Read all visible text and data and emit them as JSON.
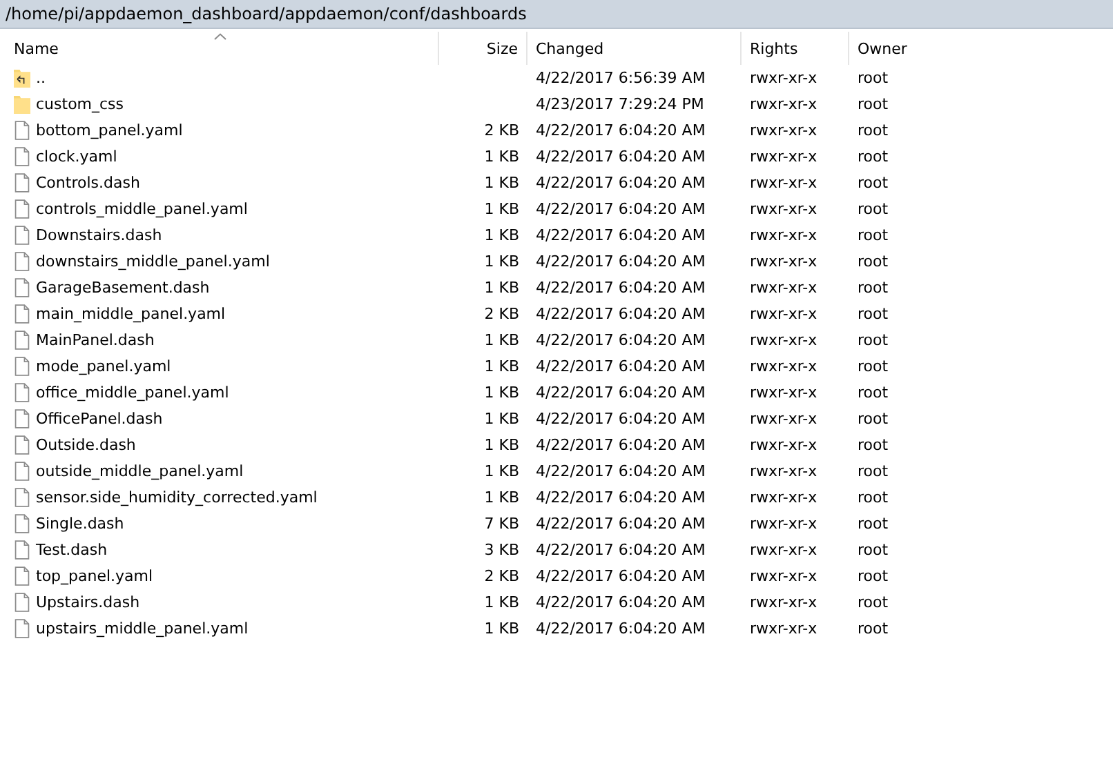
{
  "path_bar": {
    "path": "/home/pi/appdaemon_dashboard/appdaemon/conf/dashboards"
  },
  "columns": [
    {
      "label": "Name",
      "sorted": true
    },
    {
      "label": "Size",
      "sorted": false
    },
    {
      "label": "Changed",
      "sorted": false
    },
    {
      "label": "Rights",
      "sorted": false
    },
    {
      "label": "Owner",
      "sorted": false
    }
  ],
  "rows": [
    {
      "kind": "up",
      "name": "..",
      "changed": "4/22/2017 6:56:39 AM",
      "rights": "rwxr-xr-x",
      "owner": "root"
    },
    {
      "kind": "folder",
      "name": "custom_css",
      "changed": "4/23/2017 7:29:24 PM",
      "rights": "rwxr-xr-x",
      "owner": "root"
    },
    {
      "kind": "file",
      "name": "bottom_panel.yaml",
      "size": "2 KB",
      "changed": "4/22/2017 6:04:20 AM",
      "rights": "rwxr-xr-x",
      "owner": "root"
    },
    {
      "kind": "file",
      "name": "clock.yaml",
      "size": "1 KB",
      "changed": "4/22/2017 6:04:20 AM",
      "rights": "rwxr-xr-x",
      "owner": "root"
    },
    {
      "kind": "file",
      "name": "Controls.dash",
      "size": "1 KB",
      "changed": "4/22/2017 6:04:20 AM",
      "rights": "rwxr-xr-x",
      "owner": "root"
    },
    {
      "kind": "file",
      "name": "controls_middle_panel.yaml",
      "size": "1 KB",
      "changed": "4/22/2017 6:04:20 AM",
      "rights": "rwxr-xr-x",
      "owner": "root"
    },
    {
      "kind": "file",
      "name": "Downstairs.dash",
      "size": "1 KB",
      "changed": "4/22/2017 6:04:20 AM",
      "rights": "rwxr-xr-x",
      "owner": "root"
    },
    {
      "kind": "file",
      "name": "downstairs_middle_panel.yaml",
      "size": "1 KB",
      "changed": "4/22/2017 6:04:20 AM",
      "rights": "rwxr-xr-x",
      "owner": "root"
    },
    {
      "kind": "file",
      "name": "GarageBasement.dash",
      "size": "1 KB",
      "changed": "4/22/2017 6:04:20 AM",
      "rights": "rwxr-xr-x",
      "owner": "root"
    },
    {
      "kind": "file",
      "name": "main_middle_panel.yaml",
      "size": "2 KB",
      "changed": "4/22/2017 6:04:20 AM",
      "rights": "rwxr-xr-x",
      "owner": "root"
    },
    {
      "kind": "file",
      "name": "MainPanel.dash",
      "size": "1 KB",
      "changed": "4/22/2017 6:04:20 AM",
      "rights": "rwxr-xr-x",
      "owner": "root"
    },
    {
      "kind": "file",
      "name": "mode_panel.yaml",
      "size": "1 KB",
      "changed": "4/22/2017 6:04:20 AM",
      "rights": "rwxr-xr-x",
      "owner": "root"
    },
    {
      "kind": "file",
      "name": "office_middle_panel.yaml",
      "size": "1 KB",
      "changed": "4/22/2017 6:04:20 AM",
      "rights": "rwxr-xr-x",
      "owner": "root"
    },
    {
      "kind": "file",
      "name": "OfficePanel.dash",
      "size": "1 KB",
      "changed": "4/22/2017 6:04:20 AM",
      "rights": "rwxr-xr-x",
      "owner": "root"
    },
    {
      "kind": "file",
      "name": "Outside.dash",
      "size": "1 KB",
      "changed": "4/22/2017 6:04:20 AM",
      "rights": "rwxr-xr-x",
      "owner": "root"
    },
    {
      "kind": "file",
      "name": "outside_middle_panel.yaml",
      "size": "1 KB",
      "changed": "4/22/2017 6:04:20 AM",
      "rights": "rwxr-xr-x",
      "owner": "root"
    },
    {
      "kind": "file",
      "name": "sensor.side_humidity_corrected.yaml",
      "size": "1 KB",
      "changed": "4/22/2017 6:04:20 AM",
      "rights": "rwxr-xr-x",
      "owner": "root"
    },
    {
      "kind": "file",
      "name": "Single.dash",
      "size": "7 KB",
      "changed": "4/22/2017 6:04:20 AM",
      "rights": "rwxr-xr-x",
      "owner": "root"
    },
    {
      "kind": "file",
      "name": "Test.dash",
      "size": "3 KB",
      "changed": "4/22/2017 6:04:20 AM",
      "rights": "rwxr-xr-x",
      "owner": "root"
    },
    {
      "kind": "file",
      "name": "top_panel.yaml",
      "size": "2 KB",
      "changed": "4/22/2017 6:04:20 AM",
      "rights": "rwxr-xr-x",
      "owner": "root"
    },
    {
      "kind": "file",
      "name": "Upstairs.dash",
      "size": "1 KB",
      "changed": "4/22/2017 6:04:20 AM",
      "rights": "rwxr-xr-x",
      "owner": "root"
    },
    {
      "kind": "file",
      "name": "upstairs_middle_panel.yaml",
      "size": "1 KB",
      "changed": "4/22/2017 6:04:20 AM",
      "rights": "rwxr-xr-x",
      "owner": "root"
    }
  ]
}
